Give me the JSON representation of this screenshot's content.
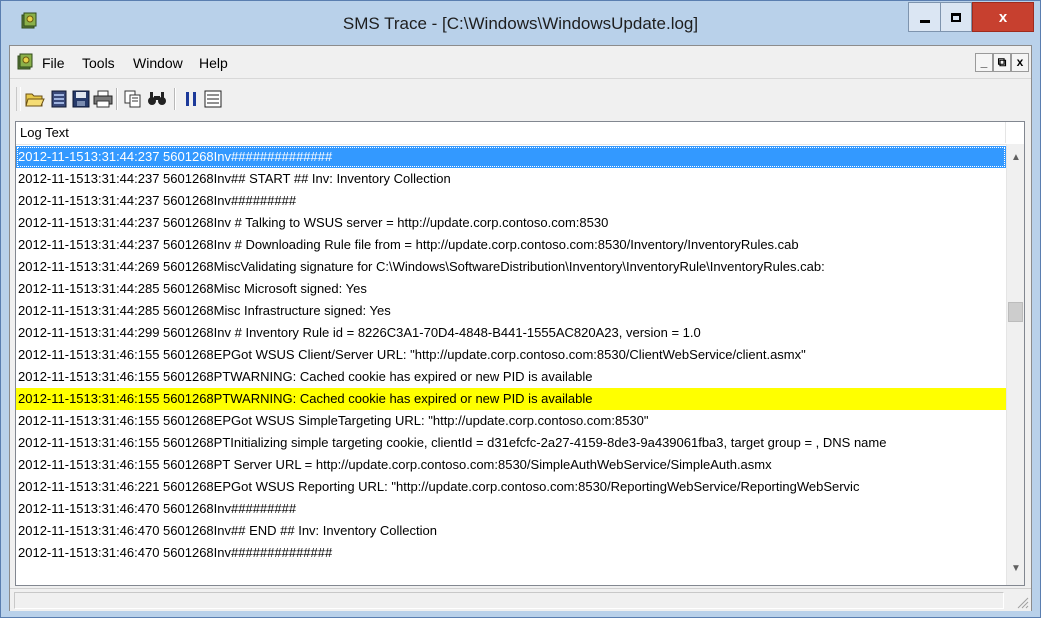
{
  "window": {
    "title": "SMS Trace - [C:\\Windows\\WindowsUpdate.log]",
    "close_label": "x"
  },
  "menu": {
    "items": [
      {
        "label": "File"
      },
      {
        "label": "Tools"
      },
      {
        "label": "Window"
      },
      {
        "label": "Help"
      }
    ],
    "mdi_minimize": "_",
    "mdi_restore": "⧉",
    "mdi_close": "x"
  },
  "toolbar": {
    "buttons": [
      "open-folder-icon",
      "server-icon",
      "save-icon",
      "print-icon",
      "copy-icon",
      "find-icon",
      "pause-icon",
      "list-icon"
    ]
  },
  "list": {
    "column_header": "Log Text",
    "selected_index": 0,
    "highlight_index": 11,
    "highlight_color": "#ffff00",
    "selection_color": "#3399ff",
    "rows": [
      "2012-11-1513:31:44:237 5601268Inv##############",
      "2012-11-1513:31:44:237 5601268Inv## START ##  Inv: Inventory Collection",
      "2012-11-1513:31:44:237 5601268Inv#########",
      "2012-11-1513:31:44:237 5601268Inv  # Talking to WSUS server = http://update.corp.contoso.com:8530",
      "2012-11-1513:31:44:237 5601268Inv  # Downloading Rule file from = http://update.corp.contoso.com:8530/Inventory/InventoryRules.cab",
      "2012-11-1513:31:44:269 5601268MiscValidating signature for C:\\Windows\\SoftwareDistribution\\Inventory\\InventoryRule\\InventoryRules.cab:",
      "2012-11-1513:31:44:285 5601268Misc Microsoft signed: Yes",
      "2012-11-1513:31:44:285 5601268Misc Infrastructure signed: Yes",
      "2012-11-1513:31:44:299 5601268Inv  # Inventory Rule id = 8226C3A1-70D4-4848-B441-1555AC820A23, version = 1.0",
      "2012-11-1513:31:46:155 5601268EPGot WSUS Client/Server URL: \"http://update.corp.contoso.com:8530/ClientWebService/client.asmx\"",
      "2012-11-1513:31:46:155 5601268PTWARNING: Cached cookie has expired or new PID is available",
      "2012-11-1513:31:46:155 5601268PTWARNING: Cached cookie has expired or new PID is available",
      "2012-11-1513:31:46:155 5601268EPGot WSUS SimpleTargeting URL: \"http://update.corp.contoso.com:8530\"",
      "2012-11-1513:31:46:155 5601268PTInitializing simple targeting cookie, clientId = d31efcfc-2a27-4159-8de3-9a439061fba3, target group = , DNS name",
      "2012-11-1513:31:46:155 5601268PT  Server URL = http://update.corp.contoso.com:8530/SimpleAuthWebService/SimpleAuth.asmx",
      "2012-11-1513:31:46:221 5601268EPGot WSUS Reporting URL: \"http://update.corp.contoso.com:8530/ReportingWebService/ReportingWebServic",
      "2012-11-1513:31:46:470 5601268Inv#########",
      "2012-11-1513:31:46:470 5601268Inv## END ## Inv: Inventory Collection",
      "2012-11-1513:31:46:470 5601268Inv##############"
    ]
  }
}
